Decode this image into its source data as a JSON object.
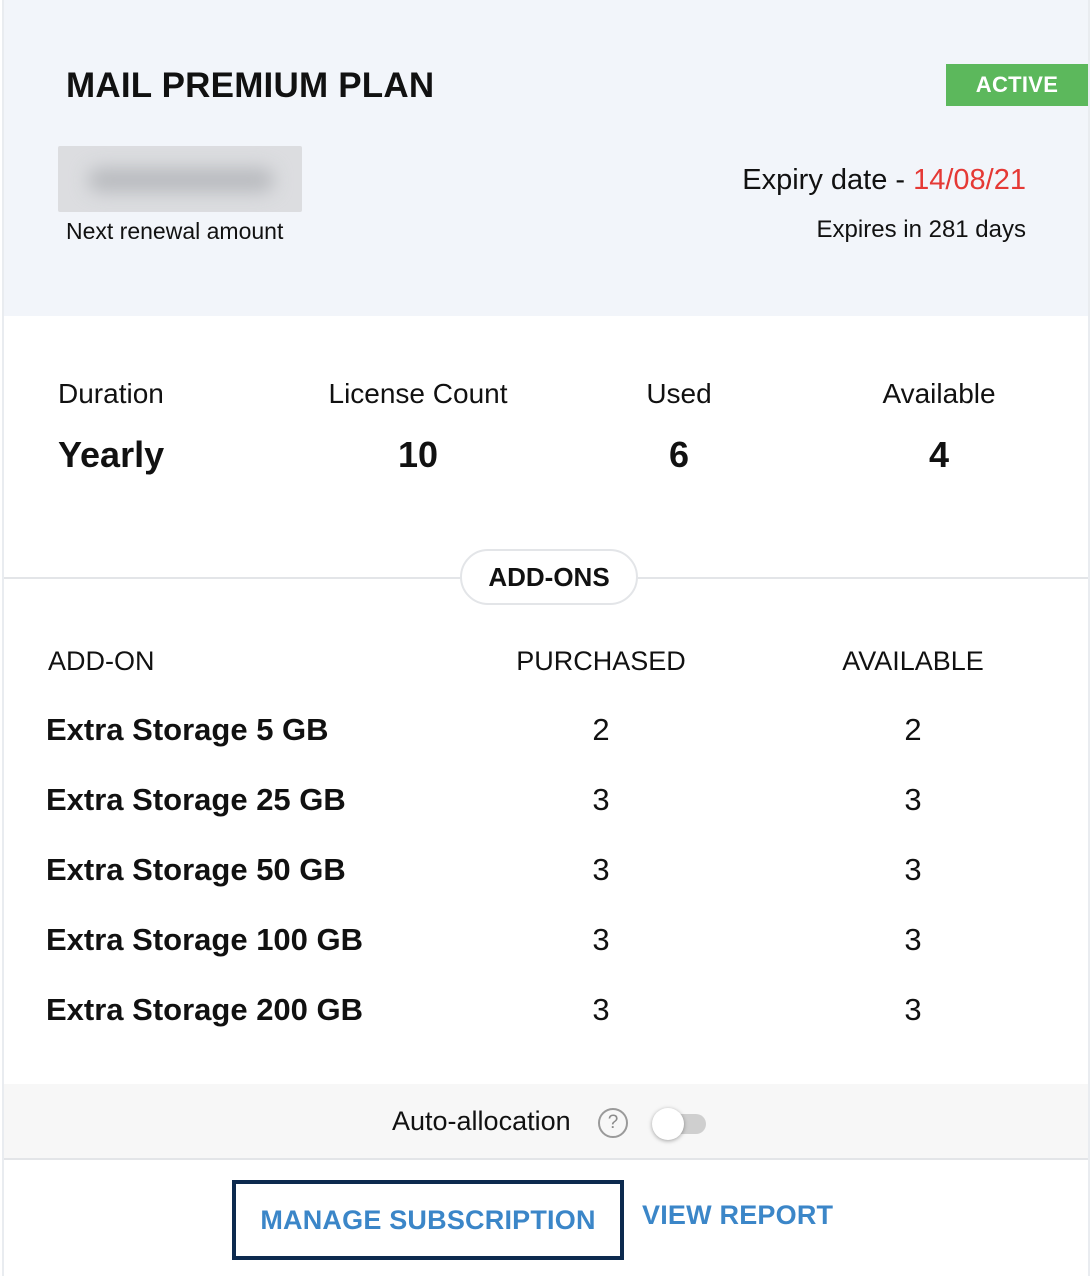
{
  "plan": {
    "title": "MAIL PREMIUM PLAN",
    "status": "ACTIVE",
    "renewal_label": "Next renewal amount",
    "expiry_prefix": "Expiry date - ",
    "expiry_date": "14/08/21",
    "expires_in": "Expires in 281 days"
  },
  "stats": {
    "duration": {
      "label": "Duration",
      "value": "Yearly"
    },
    "license_count": {
      "label": "License Count",
      "value": "10"
    },
    "used": {
      "label": "Used",
      "value": "6"
    },
    "available": {
      "label": "Available",
      "value": "4"
    }
  },
  "addons": {
    "section_title": "ADD-ONS",
    "headers": {
      "name": "ADD-ON",
      "purchased": "PURCHASED",
      "available": "AVAILABLE"
    },
    "rows": [
      {
        "name": "Extra Storage 5 GB",
        "purchased": "2",
        "available": "2"
      },
      {
        "name": "Extra Storage 25 GB",
        "purchased": "3",
        "available": "3"
      },
      {
        "name": "Extra Storage 50 GB",
        "purchased": "3",
        "available": "3"
      },
      {
        "name": "Extra Storage 100 GB",
        "purchased": "3",
        "available": "3"
      },
      {
        "name": "Extra Storage 200 GB",
        "purchased": "3",
        "available": "3"
      }
    ]
  },
  "auto_allocation": {
    "label": "Auto-allocation",
    "help_glyph": "?",
    "enabled": false
  },
  "actions": {
    "manage_label": "MANAGE SUBSCRIPTION",
    "report_label": "VIEW REPORT"
  },
  "colors": {
    "header_bg": "#f2f5fa",
    "active_badge": "#5cb85c",
    "expiry_date": "#e53935",
    "link_blue": "#3b86c8",
    "focus_border": "#0d2a4e"
  }
}
